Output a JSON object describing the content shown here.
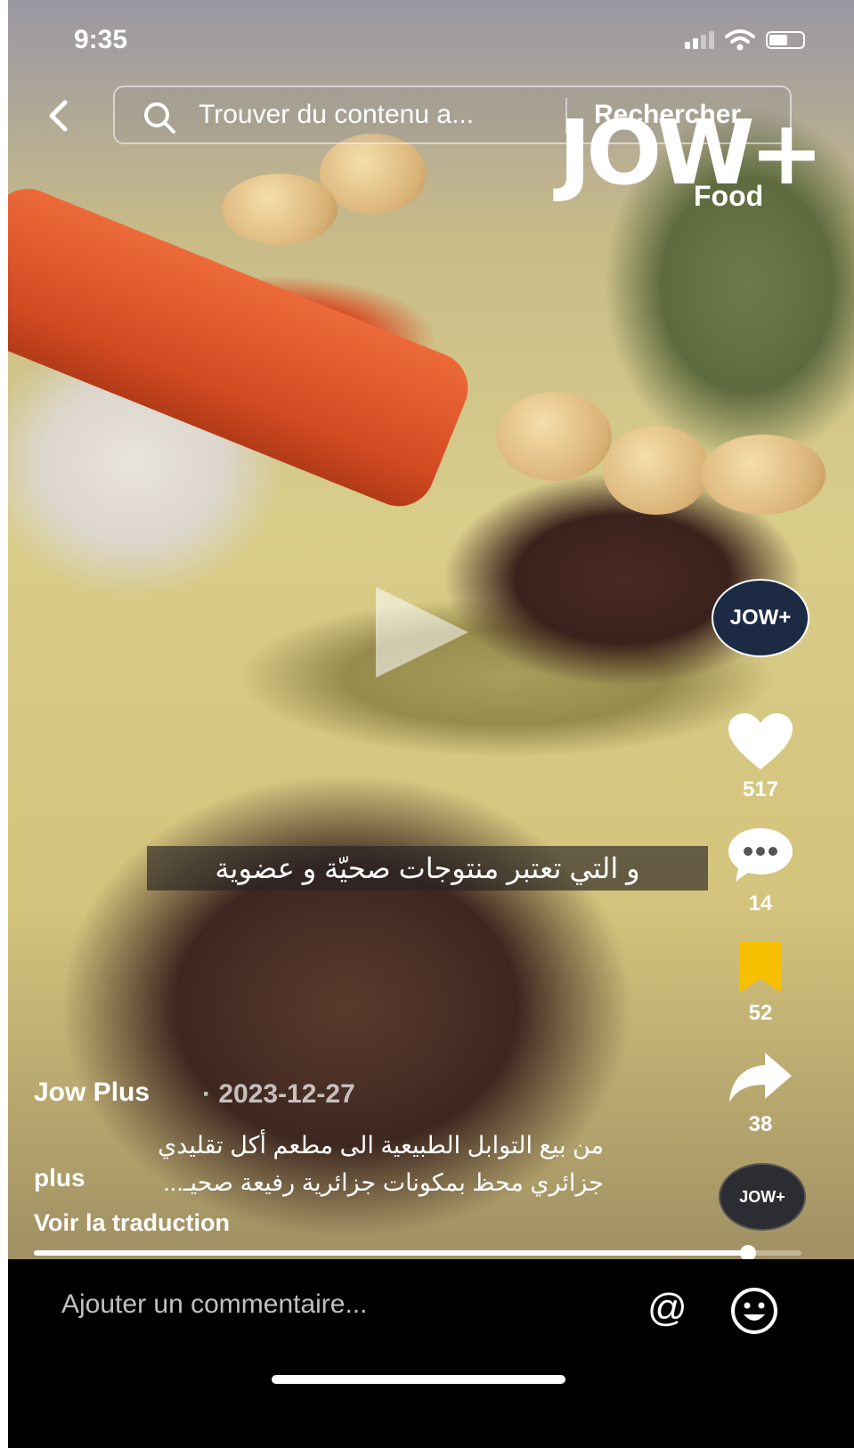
{
  "status_bar": {
    "time": "9:35"
  },
  "search": {
    "placeholder": "Trouver du contenu a...",
    "button_label": "Rechercher"
  },
  "brand": {
    "name": "JOW",
    "plus": "+",
    "sub": "Food"
  },
  "video": {
    "subtitle": "و التي تعتبر منتوجات صحيّة و عضوية",
    "progress": 0.93
  },
  "rail": {
    "avatar_label": "JOW+",
    "likes": "517",
    "comments": "14",
    "saves": "52",
    "shares": "38",
    "music_label": "JOW+"
  },
  "post": {
    "author": "Jow Plus",
    "date": "· 2023-12-27",
    "caption_line1": "من  بيع التوابل الطبيعية الى مطعم أكل تقليدي",
    "caption_line2": "جزائري محظ بمكونات جزائرية رفيعة صحيـ...",
    "more_label": "plus",
    "translate_label": "Voir la traduction"
  },
  "comment": {
    "placeholder": "Ajouter un commentaire...",
    "at_label": "@"
  },
  "colors": {
    "accent_save": "#f6c000",
    "bg": "#000000"
  }
}
